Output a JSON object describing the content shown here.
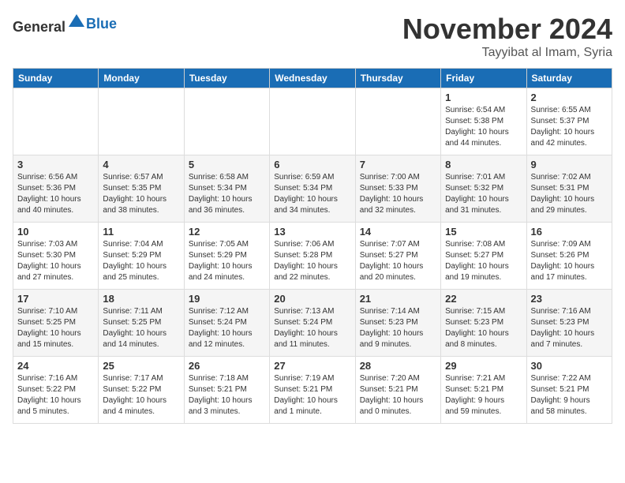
{
  "header": {
    "logo_general": "General",
    "logo_blue": "Blue",
    "month": "November 2024",
    "location": "Tayyibat al Imam, Syria"
  },
  "weekdays": [
    "Sunday",
    "Monday",
    "Tuesday",
    "Wednesday",
    "Thursday",
    "Friday",
    "Saturday"
  ],
  "weeks": [
    [
      {
        "day": "",
        "info": ""
      },
      {
        "day": "",
        "info": ""
      },
      {
        "day": "",
        "info": ""
      },
      {
        "day": "",
        "info": ""
      },
      {
        "day": "",
        "info": ""
      },
      {
        "day": "1",
        "info": "Sunrise: 6:54 AM\nSunset: 5:38 PM\nDaylight: 10 hours\nand 44 minutes."
      },
      {
        "day": "2",
        "info": "Sunrise: 6:55 AM\nSunset: 5:37 PM\nDaylight: 10 hours\nand 42 minutes."
      }
    ],
    [
      {
        "day": "3",
        "info": "Sunrise: 6:56 AM\nSunset: 5:36 PM\nDaylight: 10 hours\nand 40 minutes."
      },
      {
        "day": "4",
        "info": "Sunrise: 6:57 AM\nSunset: 5:35 PM\nDaylight: 10 hours\nand 38 minutes."
      },
      {
        "day": "5",
        "info": "Sunrise: 6:58 AM\nSunset: 5:34 PM\nDaylight: 10 hours\nand 36 minutes."
      },
      {
        "day": "6",
        "info": "Sunrise: 6:59 AM\nSunset: 5:34 PM\nDaylight: 10 hours\nand 34 minutes."
      },
      {
        "day": "7",
        "info": "Sunrise: 7:00 AM\nSunset: 5:33 PM\nDaylight: 10 hours\nand 32 minutes."
      },
      {
        "day": "8",
        "info": "Sunrise: 7:01 AM\nSunset: 5:32 PM\nDaylight: 10 hours\nand 31 minutes."
      },
      {
        "day": "9",
        "info": "Sunrise: 7:02 AM\nSunset: 5:31 PM\nDaylight: 10 hours\nand 29 minutes."
      }
    ],
    [
      {
        "day": "10",
        "info": "Sunrise: 7:03 AM\nSunset: 5:30 PM\nDaylight: 10 hours\nand 27 minutes."
      },
      {
        "day": "11",
        "info": "Sunrise: 7:04 AM\nSunset: 5:29 PM\nDaylight: 10 hours\nand 25 minutes."
      },
      {
        "day": "12",
        "info": "Sunrise: 7:05 AM\nSunset: 5:29 PM\nDaylight: 10 hours\nand 24 minutes."
      },
      {
        "day": "13",
        "info": "Sunrise: 7:06 AM\nSunset: 5:28 PM\nDaylight: 10 hours\nand 22 minutes."
      },
      {
        "day": "14",
        "info": "Sunrise: 7:07 AM\nSunset: 5:27 PM\nDaylight: 10 hours\nand 20 minutes."
      },
      {
        "day": "15",
        "info": "Sunrise: 7:08 AM\nSunset: 5:27 PM\nDaylight: 10 hours\nand 19 minutes."
      },
      {
        "day": "16",
        "info": "Sunrise: 7:09 AM\nSunset: 5:26 PM\nDaylight: 10 hours\nand 17 minutes."
      }
    ],
    [
      {
        "day": "17",
        "info": "Sunrise: 7:10 AM\nSunset: 5:25 PM\nDaylight: 10 hours\nand 15 minutes."
      },
      {
        "day": "18",
        "info": "Sunrise: 7:11 AM\nSunset: 5:25 PM\nDaylight: 10 hours\nand 14 minutes."
      },
      {
        "day": "19",
        "info": "Sunrise: 7:12 AM\nSunset: 5:24 PM\nDaylight: 10 hours\nand 12 minutes."
      },
      {
        "day": "20",
        "info": "Sunrise: 7:13 AM\nSunset: 5:24 PM\nDaylight: 10 hours\nand 11 minutes."
      },
      {
        "day": "21",
        "info": "Sunrise: 7:14 AM\nSunset: 5:23 PM\nDaylight: 10 hours\nand 9 minutes."
      },
      {
        "day": "22",
        "info": "Sunrise: 7:15 AM\nSunset: 5:23 PM\nDaylight: 10 hours\nand 8 minutes."
      },
      {
        "day": "23",
        "info": "Sunrise: 7:16 AM\nSunset: 5:23 PM\nDaylight: 10 hours\nand 7 minutes."
      }
    ],
    [
      {
        "day": "24",
        "info": "Sunrise: 7:16 AM\nSunset: 5:22 PM\nDaylight: 10 hours\nand 5 minutes."
      },
      {
        "day": "25",
        "info": "Sunrise: 7:17 AM\nSunset: 5:22 PM\nDaylight: 10 hours\nand 4 minutes."
      },
      {
        "day": "26",
        "info": "Sunrise: 7:18 AM\nSunset: 5:21 PM\nDaylight: 10 hours\nand 3 minutes."
      },
      {
        "day": "27",
        "info": "Sunrise: 7:19 AM\nSunset: 5:21 PM\nDaylight: 10 hours\nand 1 minute."
      },
      {
        "day": "28",
        "info": "Sunrise: 7:20 AM\nSunset: 5:21 PM\nDaylight: 10 hours\nand 0 minutes."
      },
      {
        "day": "29",
        "info": "Sunrise: 7:21 AM\nSunset: 5:21 PM\nDaylight: 9 hours\nand 59 minutes."
      },
      {
        "day": "30",
        "info": "Sunrise: 7:22 AM\nSunset: 5:21 PM\nDaylight: 9 hours\nand 58 minutes."
      }
    ]
  ]
}
